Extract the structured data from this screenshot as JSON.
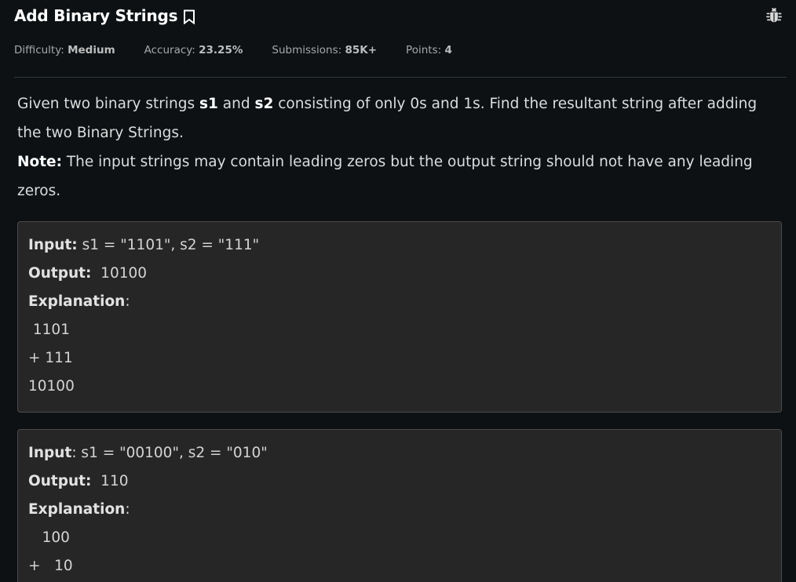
{
  "problem": {
    "title": "Add Binary Strings",
    "icons": {
      "bookmark": "bookmark-icon",
      "bug": "bug-icon"
    }
  },
  "meta": {
    "difficulty_label": "Difficulty: ",
    "difficulty_value": "Medium",
    "accuracy_label": "Accuracy: ",
    "accuracy_value": "23.25%",
    "submissions_label": "Submissions: ",
    "submissions_value": "85K+",
    "points_label": "Points: ",
    "points_value": "4"
  },
  "statement": {
    "p1_pre": "Given two binary strings ",
    "s1": "s1",
    "p1_and": " and ",
    "s2": "s2",
    "p1_post": " consisting of only 0s and 1s. Find the resultant string after adding the two Binary Strings.",
    "note_label": "Note:",
    "note_text": " The input strings may contain leading zeros but the output string should not have any leading zeros."
  },
  "examples": [
    {
      "input_label": "Input:",
      "input_value": " s1 = \"1101\", s2 = \"111\"",
      "output_label": "Output:",
      "output_value": "  10100",
      "explanation_label": "Explanation",
      "explanation_colon": ":",
      "explanation_lines": [
        " 1101",
        "+ 111",
        "10100"
      ]
    },
    {
      "input_label": "Input",
      "input_value": ": s1 = \"00100\", s2 = \"010\"",
      "output_label": "Output:",
      "output_value": "  110",
      "explanation_label": "Explanation",
      "explanation_colon": ":",
      "explanation_lines": [
        "   100",
        "+   10"
      ]
    }
  ],
  "colors": {
    "background": "#0d1114",
    "title": "#ffffff",
    "example_bg": "#262626",
    "example_border": "#4a4a4a"
  }
}
